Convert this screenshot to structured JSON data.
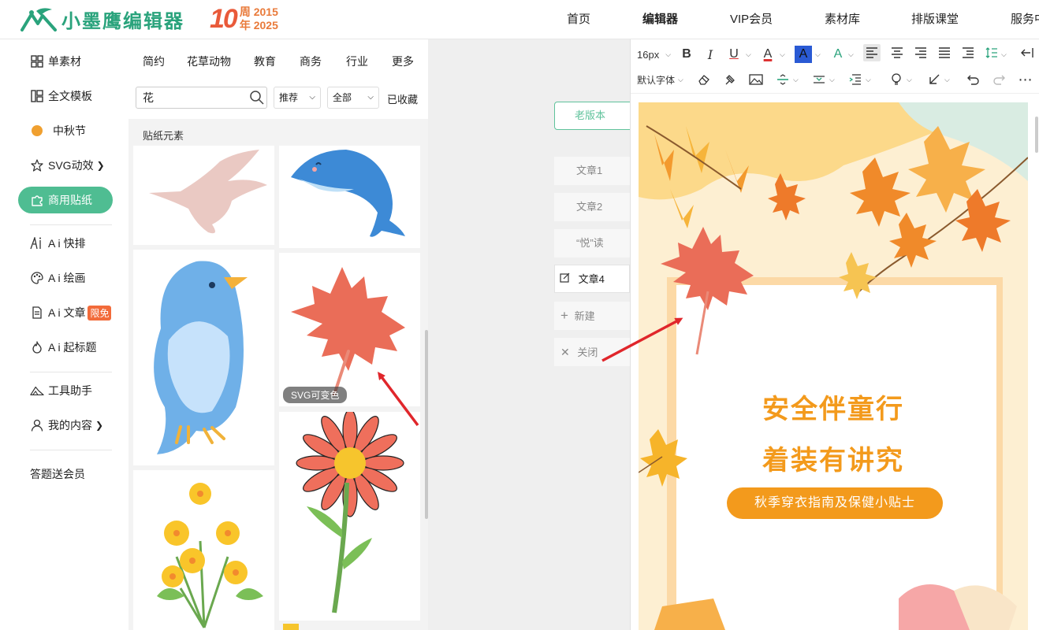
{
  "header": {
    "logo_text": "小墨鹰编辑器",
    "anniversary_number": "10",
    "anniversary_char_1": "周",
    "anniversary_char_2": "年",
    "year_start": "2015",
    "year_end": "2025",
    "nav": [
      "首页",
      "编辑器",
      "VIP会员",
      "素材库",
      "排版课堂",
      "服务中心"
    ]
  },
  "sidebar": {
    "items": [
      {
        "label": "单素材",
        "icon": "grid-icon"
      },
      {
        "label": "全文模板",
        "icon": "layout-icon"
      },
      {
        "label": "中秋节",
        "icon": "dot-icon"
      },
      {
        "label": "SVG动效",
        "icon": "star-icon"
      },
      {
        "label": "商用贴纸",
        "icon": "puzzle-icon"
      },
      {
        "label": "A i 快排",
        "icon": "ai-icon"
      },
      {
        "label": "A i 绘画",
        "icon": "palette-icon"
      },
      {
        "label": "A i 文章",
        "icon": "doc-icon"
      },
      {
        "label": "A i 起标题",
        "icon": "flame-icon"
      },
      {
        "label": "工具助手",
        "icon": "tool-icon"
      },
      {
        "label": "我的内容",
        "icon": "user-icon"
      },
      {
        "label": "答题送会员",
        "icon": ""
      }
    ],
    "badge": "限免"
  },
  "materials": {
    "categories": [
      "简约",
      "花草动物",
      "教育",
      "商务",
      "行业",
      "更多"
    ],
    "search_value": "花",
    "sort_value": "推荐",
    "filter_value": "全部",
    "favorites": "已收藏",
    "section_title": "贴纸元素",
    "svg_tag": "SVG可变色"
  },
  "articles": {
    "old_version": "老版本",
    "items": [
      "文章1",
      "文章2",
      "“悦”读",
      "文章4"
    ],
    "new_label": "新建",
    "close_label": "关闭"
  },
  "editor": {
    "font_size": "16px",
    "font_family": "默认字体",
    "headline_1": "安全伴童行",
    "headline_2": "着装有讲究",
    "subtitle": "秋季穿衣指南及保健小贴士",
    "accent_color": "#f39a1c",
    "brand_color": "#4fbd92"
  }
}
